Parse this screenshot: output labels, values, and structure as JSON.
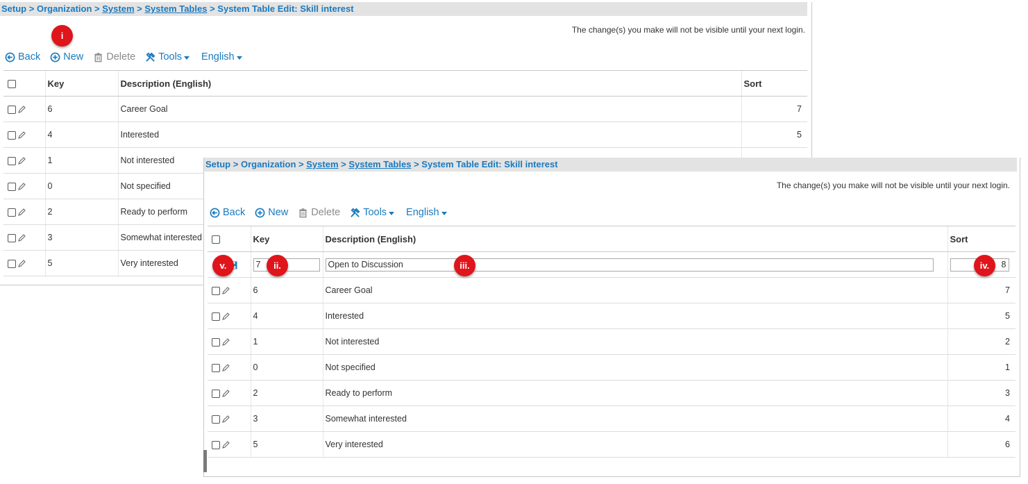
{
  "breadcrumb": {
    "setup": "Setup",
    "organization": "Organization",
    "system": "System",
    "system_tables": "System Tables",
    "current": "System Table Edit: Skill interest",
    "separator": ">"
  },
  "notice": "The change(s) you make will not be visible until your next login.",
  "toolbar": {
    "back": "Back",
    "new": "New",
    "delete": "Delete",
    "tools": "Tools",
    "language": "English"
  },
  "columns": {
    "key": "Key",
    "description": "Description (English)",
    "sort": "Sort"
  },
  "back_rows": [
    {
      "key": "6",
      "description": "Career Goal",
      "sort": "7"
    },
    {
      "key": "4",
      "description": "Interested",
      "sort": "5"
    },
    {
      "key": "1",
      "description": "Not interested",
      "sort": ""
    },
    {
      "key": "0",
      "description": "Not specified",
      "sort": ""
    },
    {
      "key": "2",
      "description": "Ready to perform",
      "sort": ""
    },
    {
      "key": "3",
      "description": "Somewhat interested",
      "sort": ""
    },
    {
      "key": "5",
      "description": "Very interested",
      "sort": ""
    }
  ],
  "new_row": {
    "key": "7",
    "description": "Open to Discussion",
    "sort": "8"
  },
  "front_rows": [
    {
      "key": "6",
      "description": "Career Goal",
      "sort": "7"
    },
    {
      "key": "4",
      "description": "Interested",
      "sort": "5"
    },
    {
      "key": "1",
      "description": "Not interested",
      "sort": "2"
    },
    {
      "key": "0",
      "description": "Not specified",
      "sort": "1"
    },
    {
      "key": "2",
      "description": "Ready to perform",
      "sort": "3"
    },
    {
      "key": "3",
      "description": "Somewhat interested",
      "sort": "4"
    },
    {
      "key": "5",
      "description": "Very interested",
      "sort": "6"
    }
  ],
  "markers": {
    "m1": "i",
    "m2": "ii.",
    "m3": "iii.",
    "m4": "iv.",
    "m5": "v."
  },
  "colors": {
    "link": "#1a7abf",
    "marker": "#e0141b",
    "breadcrumb_bg": "#e3e3e3"
  }
}
